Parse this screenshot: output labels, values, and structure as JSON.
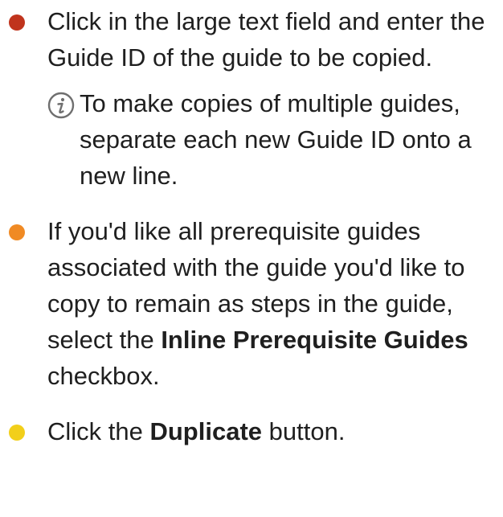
{
  "steps": [
    {
      "bullet_color": "#c0341d",
      "text": "Click in the large text field and enter the Guide ID of the guide to be copied.",
      "note": {
        "icon": "info-icon",
        "text": "To make copies of multiple guides, separate each new Guide ID onto a new line."
      }
    },
    {
      "bullet_color": "#f08a24",
      "text_before": "If you'd like all prerequisite guides associated with the guide you'd like to copy to remain as steps in the guide, select the ",
      "bold": "Inline Prerequisite Guides",
      "text_after": " checkbox."
    },
    {
      "bullet_color": "#f2cf1a",
      "text_before": "Click the ",
      "bold": "Duplicate",
      "text_after": " button."
    }
  ]
}
